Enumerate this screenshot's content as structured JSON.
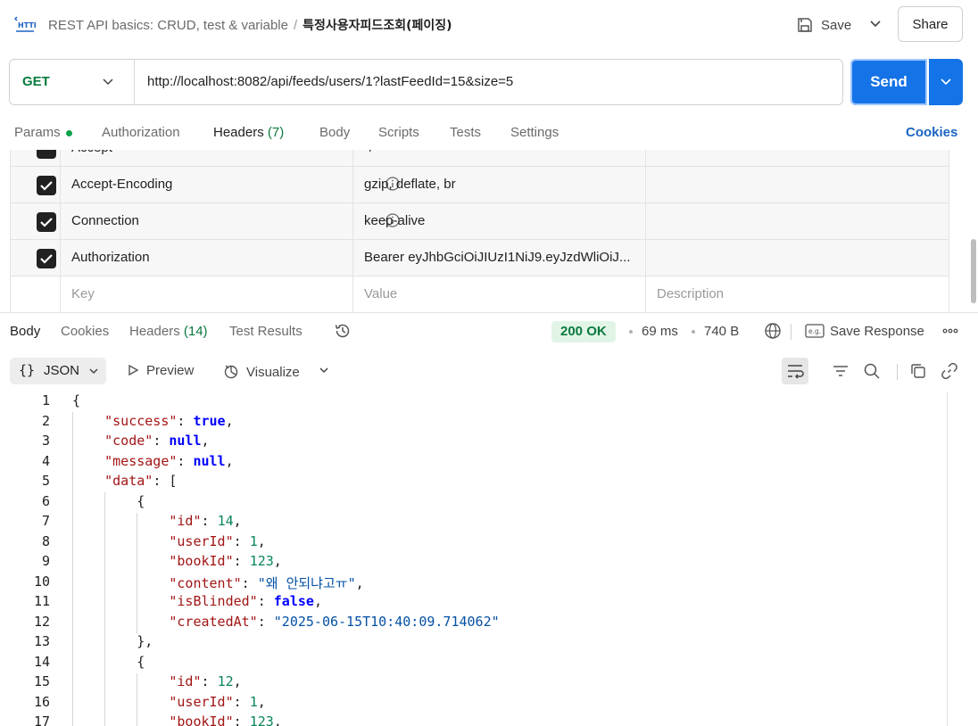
{
  "topbar": {
    "breadcrumb_parent": "REST API basics: CRUD, test & variable",
    "breadcrumb_sep": "/",
    "breadcrumb_current": "특정사용자피드조회(페이징)",
    "save_label": "Save",
    "share_label": "Share"
  },
  "request": {
    "method": "GET",
    "url": "http://localhost:8082/api/feeds/users/1?lastFeedId=15&size=5",
    "send_label": "Send"
  },
  "request_tabs": {
    "params": "Params",
    "authorization": "Authorization",
    "headers": "Headers",
    "headers_count": "(7)",
    "body": "Body",
    "scripts": "Scripts",
    "tests": "Tests",
    "settings": "Settings",
    "cookies": "Cookies"
  },
  "headers_table": {
    "rows": [
      {
        "key": "Accept",
        "value": "*/*",
        "description": "",
        "checked": true
      },
      {
        "key": "Accept-Encoding",
        "value": "gzip, deflate, br",
        "description": "",
        "checked": true
      },
      {
        "key": "Connection",
        "value": "keep-alive",
        "description": "",
        "checked": true
      },
      {
        "key": "Authorization",
        "value": "Bearer eyJhbGciOiJIUzI1NiJ9.eyJzdWliOiJ...",
        "description": "",
        "checked": true
      }
    ],
    "placeholder_key": "Key",
    "placeholder_value": "Value",
    "placeholder_description": "Description"
  },
  "response_tabs": {
    "body": "Body",
    "cookies": "Cookies",
    "headers": "Headers",
    "headers_count": "(14)",
    "test_results": "Test Results"
  },
  "response_meta": {
    "status": "200 OK",
    "time": "69 ms",
    "size": "740 B",
    "save_response": "Save Response"
  },
  "response_toolbar": {
    "format": "JSON",
    "preview": "Preview",
    "visualize": "Visualize"
  },
  "colors": {
    "accent_orange": "#ff6c37",
    "send_blue": "#1473e6",
    "status_green": "#0a7a3e"
  },
  "code_lines": [
    {
      "num": "1"
    },
    {
      "num": "2"
    },
    {
      "num": "3"
    },
    {
      "num": "4"
    },
    {
      "num": "5"
    },
    {
      "num": "6"
    },
    {
      "num": "7"
    },
    {
      "num": "8"
    },
    {
      "num": "9"
    },
    {
      "num": "10"
    },
    {
      "num": "11"
    },
    {
      "num": "12"
    },
    {
      "num": "13"
    },
    {
      "num": "14"
    },
    {
      "num": "15"
    },
    {
      "num": "16"
    },
    {
      "num": "17"
    }
  ],
  "json": {
    "k_success": "\"success\"",
    "v_success": "true",
    "k_code": "\"code\"",
    "v_code": "null",
    "k_message": "\"message\"",
    "v_message": "null",
    "k_data": "\"data\"",
    "k_id": "\"id\"",
    "v_id_1": "14",
    "v_id_2": "12",
    "k_userId": "\"userId\"",
    "v_userId_1": "1",
    "v_userId_2": "1",
    "k_bookId": "\"bookId\"",
    "v_bookId_1": "123",
    "v_bookId_2": "123",
    "k_content": "\"content\"",
    "v_content_1": "\"왜 안되냐고ㅠ\"",
    "k_isBlinded": "\"isBlinded\"",
    "v_isBlinded_1": "false",
    "k_createdAt": "\"createdAt\"",
    "v_createdAt_1": "\"2025-06-15T10:40:09.714062\""
  }
}
